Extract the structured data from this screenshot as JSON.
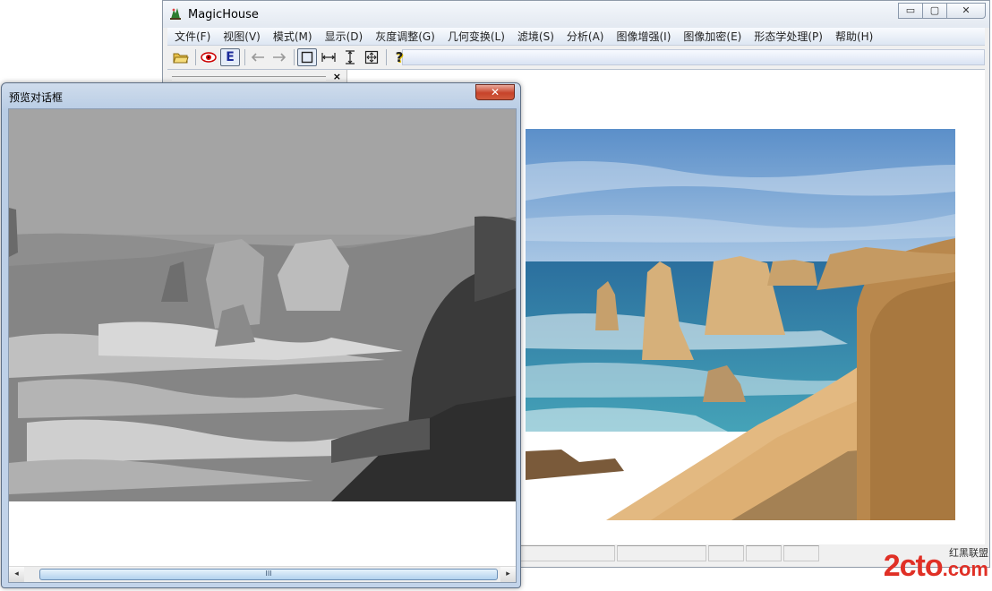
{
  "main_window": {
    "title": "MagicHouse",
    "controls": {
      "minimize": "▭",
      "maximize": "▢",
      "close": "✕"
    }
  },
  "menu": {
    "items": [
      "文件(F)",
      "视图(V)",
      "模式(M)",
      "显示(D)",
      "灰度调整(G)",
      "几何变换(L)",
      "滤境(S)",
      "分析(A)",
      "图像增强(I)",
      "图像加密(E)",
      "形态学处理(P)",
      "帮助(H)"
    ]
  },
  "toolbar": {
    "buttons": [
      {
        "icon": "open-folder-icon"
      },
      {
        "icon": "eye-icon"
      },
      {
        "icon": "edit-icon",
        "label": "E"
      },
      {
        "icon": "arrow-left-icon"
      },
      {
        "icon": "arrow-right-icon"
      },
      {
        "icon": "actual-size-icon"
      },
      {
        "icon": "fit-width-icon"
      },
      {
        "icon": "fit-height-icon"
      },
      {
        "icon": "fit-window-icon"
      },
      {
        "icon": "help-icon",
        "label": "?"
      }
    ]
  },
  "side_pane": {
    "close": "×"
  },
  "preview_dialog": {
    "title": "预览对话框",
    "close": "✕",
    "scrollbar": {
      "left": "◂",
      "right": "▸",
      "grip": "III"
    }
  },
  "watermark": {
    "logo": "2cto",
    "domain": ".com",
    "tagline": "红黑联盟"
  },
  "colors": {
    "menubar": "#dde6f2",
    "title_close_red": "#c7432a",
    "sea": "#2e7fb5",
    "sand": "#e3b981",
    "cliff": "#b9884d",
    "watermark_red": "#e03026"
  }
}
